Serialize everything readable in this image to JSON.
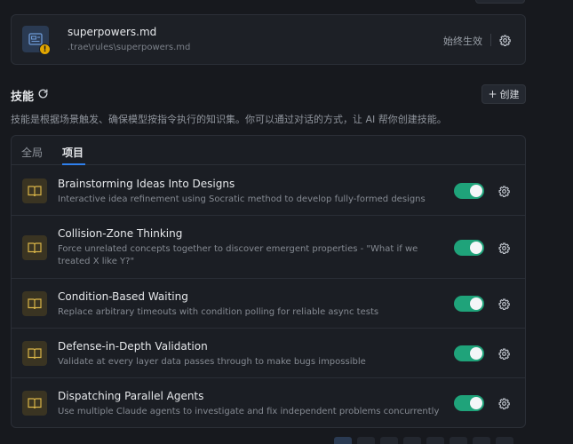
{
  "rules": {
    "file_name": "superpowers.md",
    "file_path": ".trae\\rules\\superpowers.md",
    "mode_label": "始终生效",
    "badge": "!"
  },
  "skills": {
    "title": "技能",
    "create_label": "创建",
    "description": "技能是根据场景触发、确保模型按指令执行的知识集。你可以通过对话的方式，让 AI 帮你创建技能。",
    "tabs": [
      {
        "label": "全局",
        "active": false
      },
      {
        "label": "项目",
        "active": true
      }
    ],
    "items": [
      {
        "title": "Brainstorming Ideas Into Designs",
        "desc": "Interactive idea refinement using Socratic method to develop fully-formed designs",
        "enabled": true
      },
      {
        "title": "Collision-Zone Thinking",
        "desc": "Force unrelated concepts together to discover emergent properties - \"What if we treated X like Y?\"",
        "enabled": true
      },
      {
        "title": "Condition-Based Waiting",
        "desc": "Replace arbitrary timeouts with condition polling for reliable async tests",
        "enabled": true
      },
      {
        "title": "Defense-in-Depth Validation",
        "desc": "Validate at every layer data passes through to make bugs impossible",
        "enabled": true
      },
      {
        "title": "Dispatching Parallel Agents",
        "desc": "Use multiple Claude agents to investigate and fix independent problems concurrently",
        "enabled": true
      }
    ]
  },
  "colors": {
    "toggle_on": "#1fa37a",
    "accent": "#2f80ed",
    "badge": "#e1a600"
  }
}
